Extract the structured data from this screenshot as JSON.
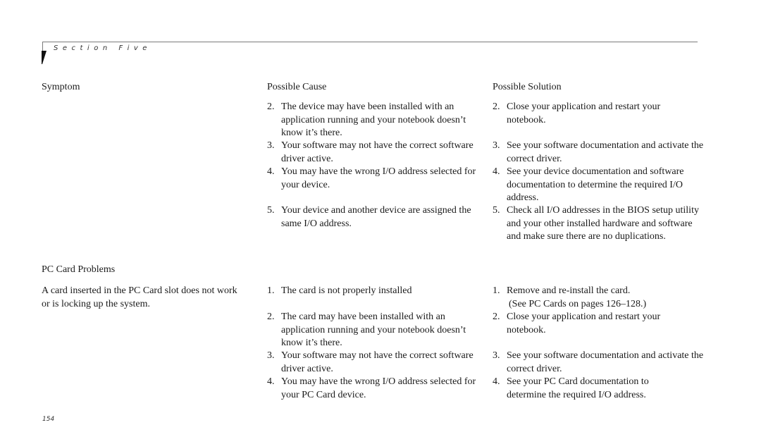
{
  "header": {
    "section_label": "Section Five"
  },
  "columns": {
    "symptom": "Symptom",
    "cause": "Possible Cause",
    "solution": "Possible Solution"
  },
  "group1": {
    "causes": [
      {
        "num": "2.",
        "text": "The device may have been installed with an application running and your notebook doesn’t know it’s there."
      },
      {
        "num": "3.",
        "text": "Your software may not have the correct software driver active."
      },
      {
        "num": "4.",
        "text": "You may have the wrong I/O address selected for your device."
      },
      {
        "num": "5.",
        "text": "Your device and another device are assigned the same I/O address."
      }
    ],
    "solutions": [
      {
        "num": "2.",
        "text": "Close your application and restart your notebook."
      },
      {
        "num": "3.",
        "text": "See your software documentation and activate the correct driver."
      },
      {
        "num": "4.",
        "text": "See your device documentation and software documentation to determine the required I/O address."
      },
      {
        "num": "5.",
        "text": "Check all I/O addresses in the BIOS setup utility and your other installed hardware and software and make sure there are no duplications."
      }
    ]
  },
  "group2": {
    "title": "PC Card Problems",
    "symptom": "A card inserted in the PC Card slot does not work or is locking up the system.",
    "causes": [
      {
        "num": "1.",
        "text": "The card is not properly installed"
      },
      {
        "num": "2.",
        "text": "The card may have been installed with an application running and your notebook doesn’t know it’s there."
      },
      {
        "num": "3.",
        "text": "Your software may not have the correct software driver active."
      },
      {
        "num": "4.",
        "text": "You may have the wrong I/O address selected for your PC Card device."
      }
    ],
    "solutions": [
      {
        "num": "1.",
        "text": "Remove and re-install the card.",
        "note": "(See PC Cards on pages 126–128.)"
      },
      {
        "num": "2.",
        "text": "Close your application and restart your notebook."
      },
      {
        "num": "3.",
        "text": "See your software documentation and activate the correct driver."
      },
      {
        "num": "4.",
        "text": "See your PC Card documentation to determine the required I/O address."
      }
    ]
  },
  "footer": {
    "page_number": "154"
  }
}
